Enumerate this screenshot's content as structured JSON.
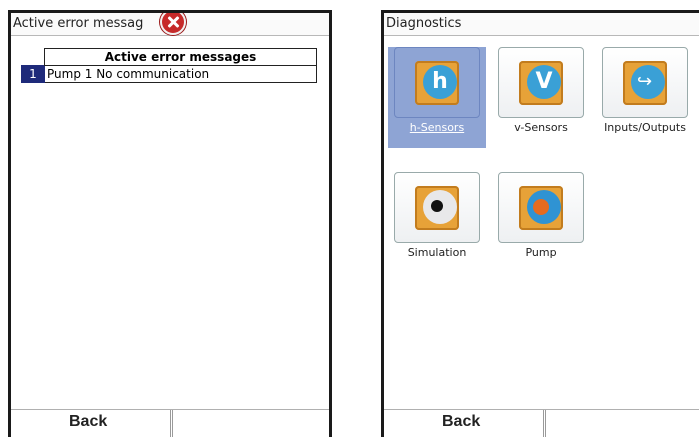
{
  "left_screen": {
    "title": "Active error messag",
    "table_header": "Active error messages",
    "rows": [
      {
        "index": "1",
        "message": "Pump 1 No communication"
      }
    ],
    "footer": {
      "back_label": "Back",
      "right_label": ""
    }
  },
  "right_screen": {
    "title": "Diagnostics",
    "tiles": [
      {
        "label": "h-Sensors",
        "icon": "h-sensors-icon",
        "glyph": "h",
        "selected": true
      },
      {
        "label": "v-Sensors",
        "icon": "v-sensors-icon",
        "glyph": "V",
        "selected": false
      },
      {
        "label": "Inputs/Outputs",
        "icon": "inputs-outputs-icon",
        "glyph": "",
        "selected": false
      },
      {
        "label": "Simulation",
        "icon": "simulation-icon",
        "glyph": "",
        "selected": false
      },
      {
        "label": "Pump",
        "icon": "pump-icon",
        "glyph": "",
        "selected": false
      }
    ],
    "footer": {
      "back_label": "Back",
      "right_label": ""
    }
  },
  "colors": {
    "selection": "#8ea4d4",
    "index_bg": "#1e2a7a",
    "close_icon": "#c62a2a",
    "icon_orange": "#e7a238",
    "icon_blue": "#3aa0d6"
  }
}
